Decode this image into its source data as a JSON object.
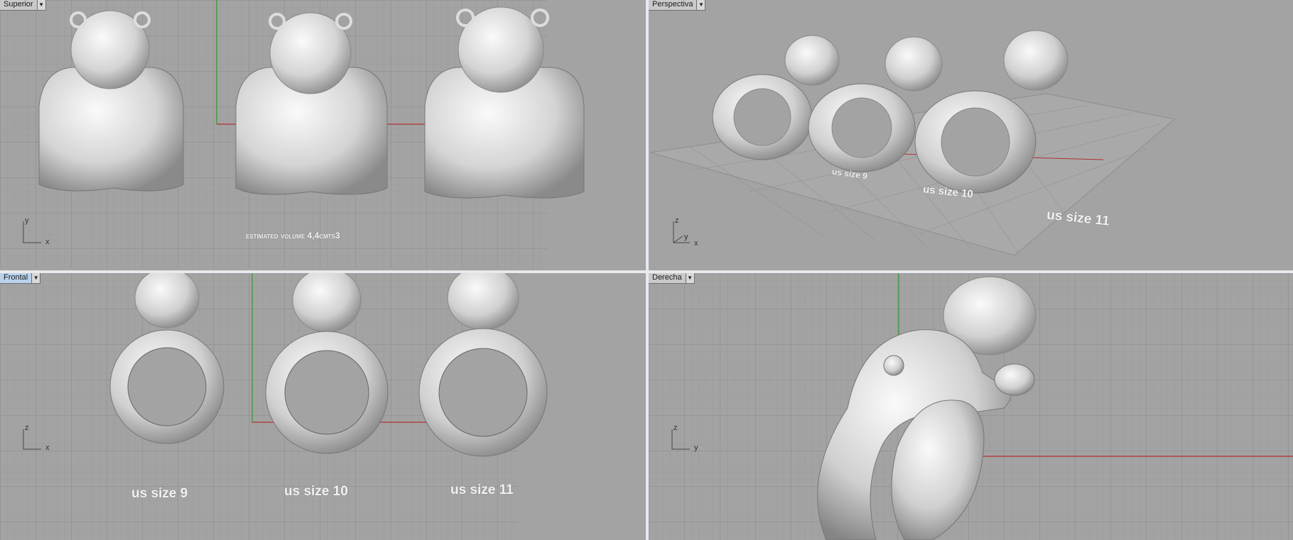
{
  "viewports": {
    "top": {
      "label": "Superior",
      "active": false,
      "annotation": "estimated volume 4,4cmts3",
      "axes": [
        "y",
        "x"
      ]
    },
    "perspective": {
      "label": "Perspectiva",
      "active": false,
      "axes": [
        "z",
        "y",
        "x"
      ],
      "labels": [
        "us size 9",
        "us size 10",
        "us size 11"
      ]
    },
    "front": {
      "label": "Frontal",
      "active": true,
      "axes": [
        "z",
        "x"
      ],
      "labels": [
        "us size 9",
        "us size 10",
        "us size 11"
      ]
    },
    "right": {
      "label": "Derecha",
      "active": false,
      "axes": [
        "z",
        "y"
      ]
    }
  },
  "icons": {
    "viewport_menu": "dropdown-arrow-icon"
  },
  "colors": {
    "viewport_bg": "#a3a3a3",
    "grid": "#8f8f8f",
    "axis_x": "#b03030",
    "axis_y": "#2e9a2e",
    "active_tab": "#b9d2ea",
    "separator": "#e6e9ee"
  }
}
